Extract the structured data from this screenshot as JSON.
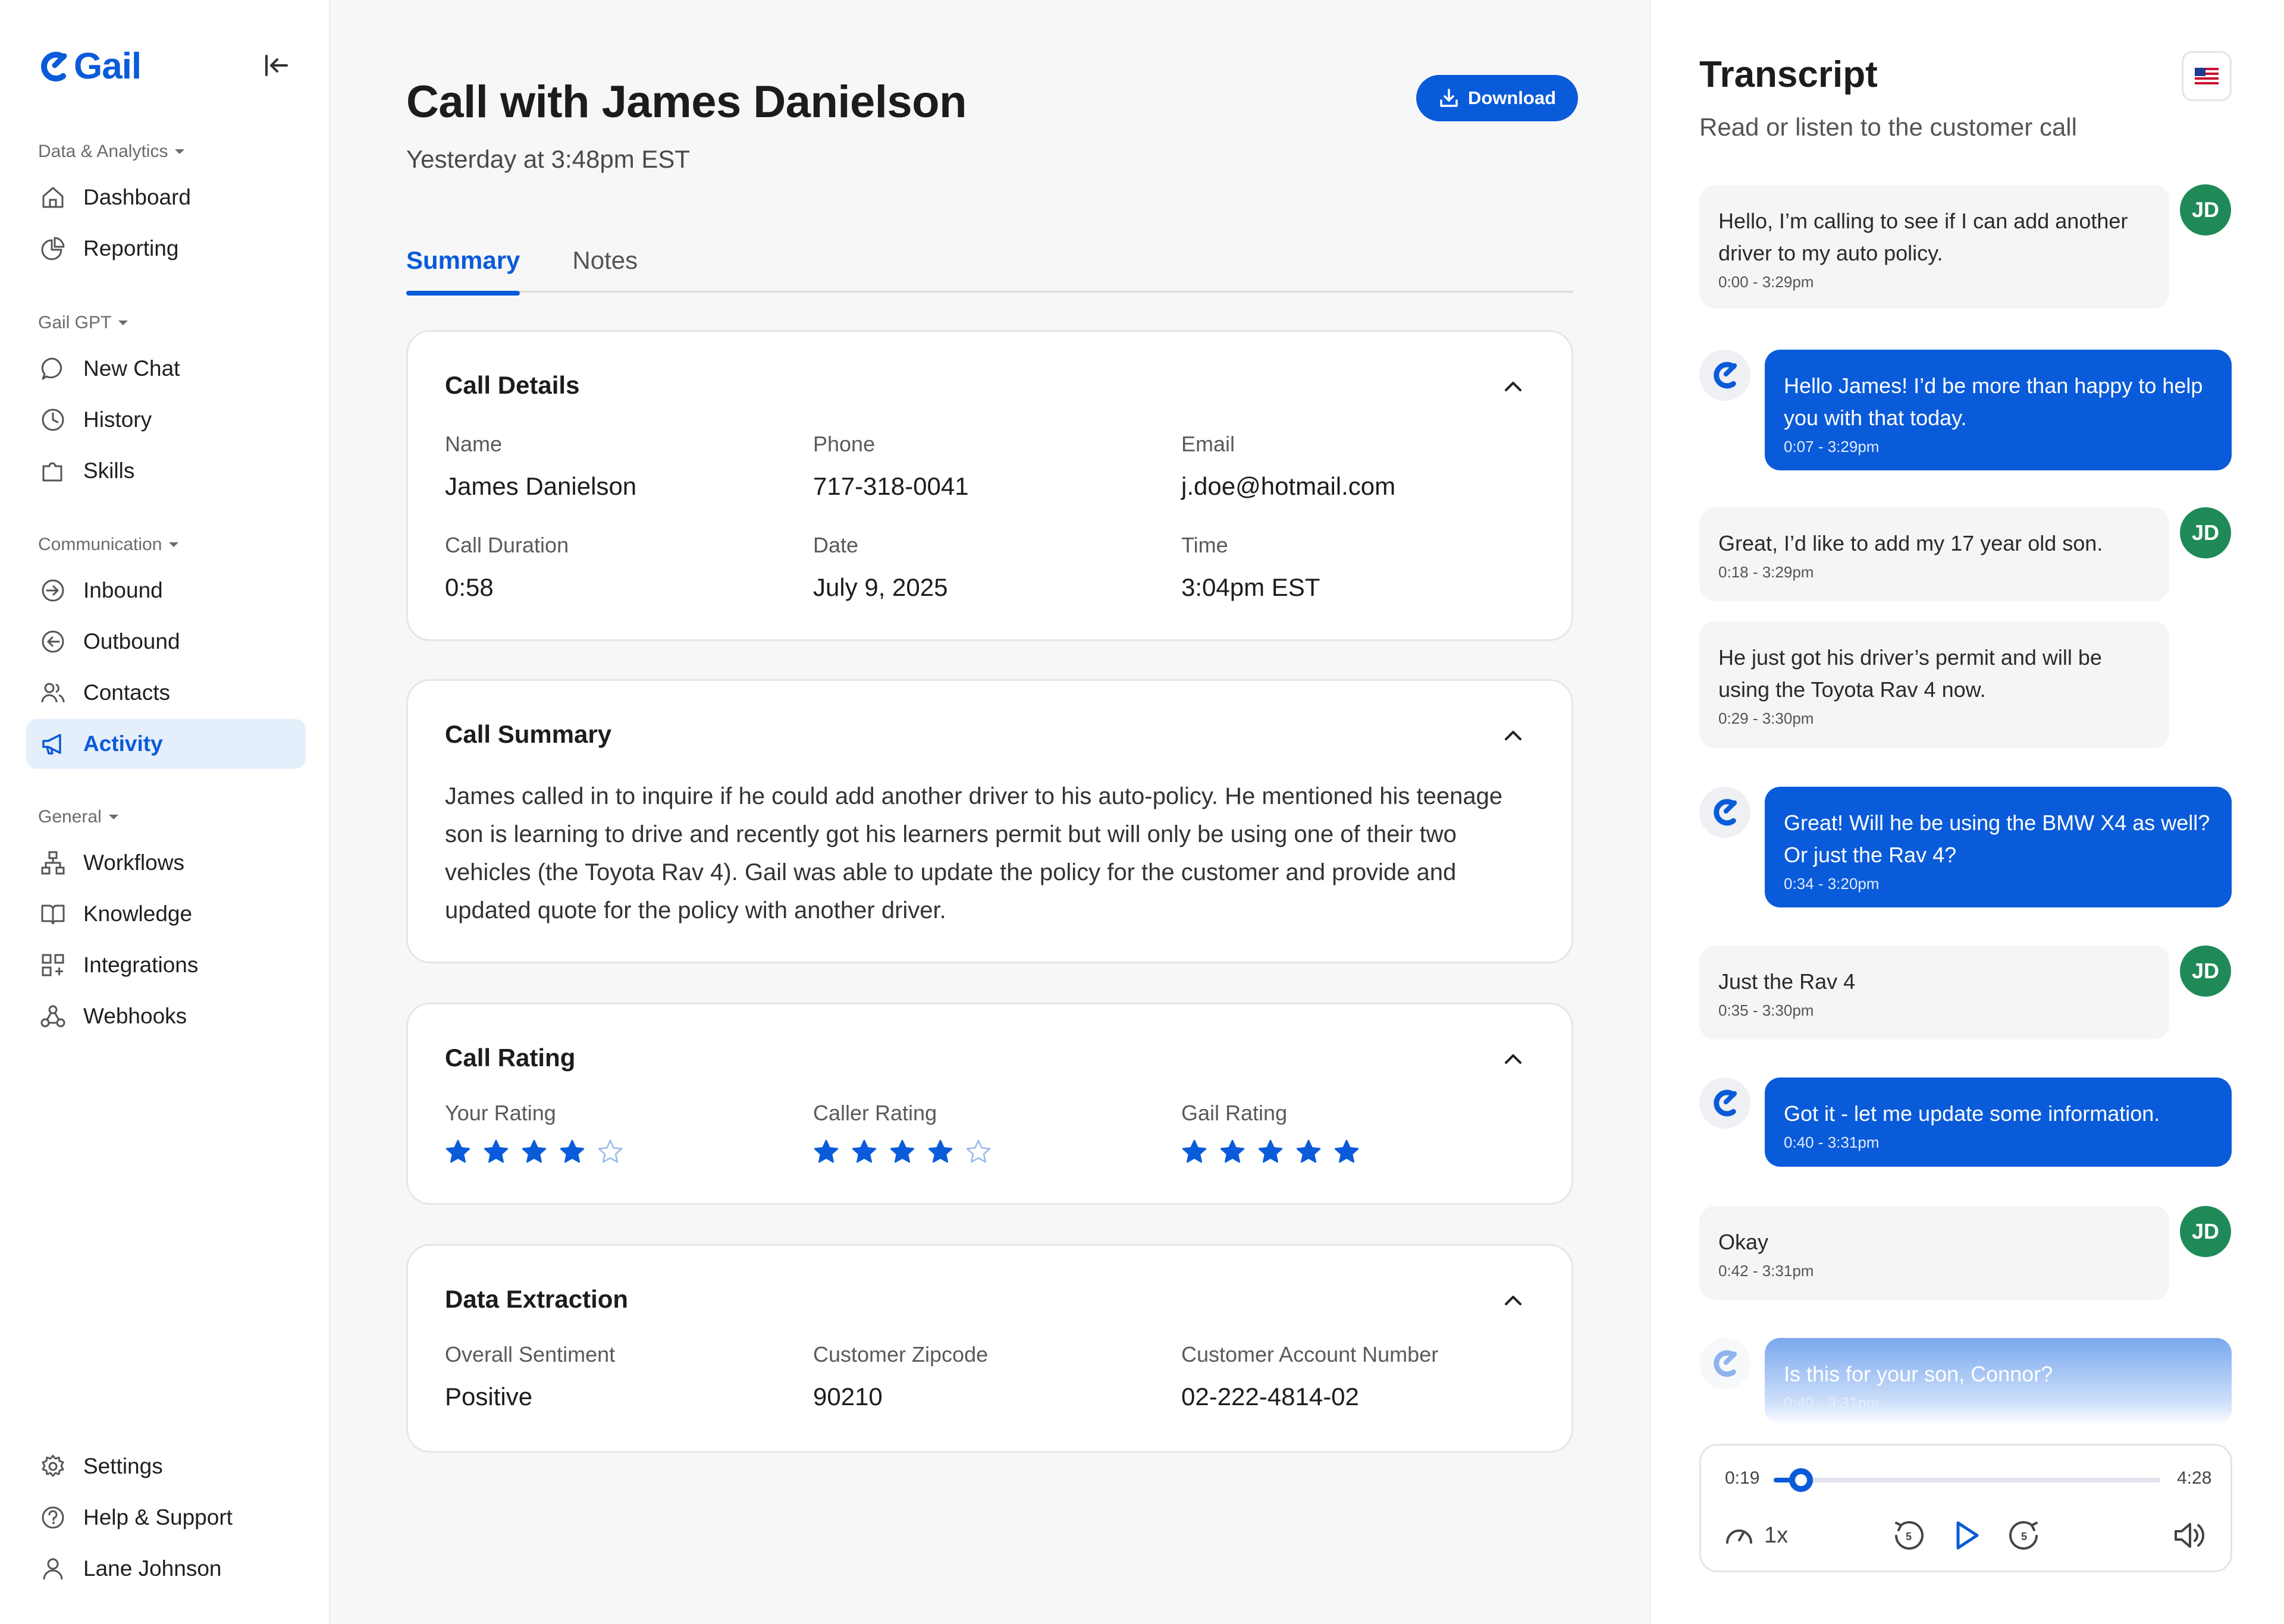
{
  "app": {
    "logo_text": "Gail"
  },
  "sidebar": {
    "sections": [
      {
        "label": "Data & Analytics",
        "items": [
          {
            "label": "Dashboard"
          },
          {
            "label": "Reporting"
          }
        ]
      },
      {
        "label": "Gail GPT",
        "items": [
          {
            "label": "New Chat"
          },
          {
            "label": "History"
          },
          {
            "label": "Skills"
          }
        ]
      },
      {
        "label": "Communication",
        "items": [
          {
            "label": "Inbound"
          },
          {
            "label": "Outbound"
          },
          {
            "label": "Contacts"
          },
          {
            "label": "Activity",
            "active": true
          }
        ]
      },
      {
        "label": "General",
        "items": [
          {
            "label": "Workflows"
          },
          {
            "label": "Knowledge"
          },
          {
            "label": "Integrations"
          },
          {
            "label": "Webhooks"
          }
        ]
      }
    ],
    "footer": [
      {
        "label": "Settings"
      },
      {
        "label": "Help & Support"
      },
      {
        "label": "Lane Johnson"
      }
    ]
  },
  "main": {
    "title": "Call with James Danielson",
    "subtitle": "Yesterday at 3:48pm EST",
    "download_label": "Download",
    "tabs": [
      {
        "label": "Summary",
        "active": true
      },
      {
        "label": "Notes"
      }
    ],
    "call_details": {
      "title": "Call Details",
      "fields": [
        {
          "label": "Name",
          "value": "James Danielson"
        },
        {
          "label": "Phone",
          "value": "717-318-0041"
        },
        {
          "label": "Email",
          "value": "j.doe@hotmail.com"
        },
        {
          "label": "Call Duration",
          "value": "0:58"
        },
        {
          "label": "Date",
          "value": "July 9, 2025"
        },
        {
          "label": "Time",
          "value": "3:04pm EST"
        }
      ]
    },
    "call_summary": {
      "title": "Call Summary",
      "text": "James called in to inquire if he could add another driver to his auto-policy. He mentioned his teenage son is learning to drive and recently got his learners permit but will only be using one of their two vehicles (the Toyota Rav 4). Gail was able to update the policy for the customer and provide and updated quote for the policy with another driver."
    },
    "call_rating": {
      "title": "Call Rating",
      "ratings": [
        {
          "label": "Your Rating",
          "stars": 4,
          "max": 5
        },
        {
          "label": "Caller Rating",
          "stars": 4,
          "max": 5
        },
        {
          "label": "Gail Rating",
          "stars": 5,
          "max": 5
        }
      ]
    },
    "data_extraction": {
      "title": "Data Extraction",
      "fields": [
        {
          "label": "Overall Sentiment",
          "value": "Positive"
        },
        {
          "label": "Customer Zipcode",
          "value": "90210"
        },
        {
          "label": "Customer Account Number",
          "value": "02-222-4814-02"
        }
      ]
    }
  },
  "transcript": {
    "title": "Transcript",
    "subtitle": "Read or listen to the customer call",
    "flag_icon": "us-flag-icon",
    "avatar_initials": "JD",
    "messages": [
      {
        "speaker": "customer",
        "text": "Hello, I’m calling to see if I can add another driver to my auto policy.",
        "time": "0:00 - 3:29pm"
      },
      {
        "speaker": "agent",
        "text": "Hello James! I’d be more than happy to help you with that today.",
        "time": "0:07 - 3:29pm"
      },
      {
        "speaker": "customer",
        "text": "Great, I’d like to add my 17 year old son.",
        "time": "0:18 - 3:29pm"
      },
      {
        "speaker": "customer",
        "text": "He just got his driver’s permit and will be using the Toyota Rav 4 now.",
        "time": "0:29 - 3:30pm"
      },
      {
        "speaker": "agent",
        "text": "Great! Will he be using the BMW X4 as well? Or just the Rav 4?",
        "time": "0:34 - 3:20pm"
      },
      {
        "speaker": "customer",
        "text": "Just the Rav 4",
        "time": "0:35 - 3:30pm"
      },
      {
        "speaker": "agent",
        "text": "Got it - let me update some information.",
        "time": "0:40 - 3:31pm"
      },
      {
        "speaker": "customer",
        "text": "Okay",
        "time": "0:42 - 3:31pm"
      },
      {
        "speaker": "agent",
        "text": "Is this for your son, Connor?",
        "time": "0:40 - 3:31pm"
      }
    ],
    "player": {
      "current_time": "0:19",
      "total_time": "4:28",
      "progress": 0.071,
      "speed": "1x",
      "skip_back_seconds": "5",
      "skip_forward_seconds": "5"
    }
  },
  "colors": {
    "accent": "#0a5bd9",
    "avatar": "#1f8a57",
    "active_bg": "#e5effc"
  }
}
